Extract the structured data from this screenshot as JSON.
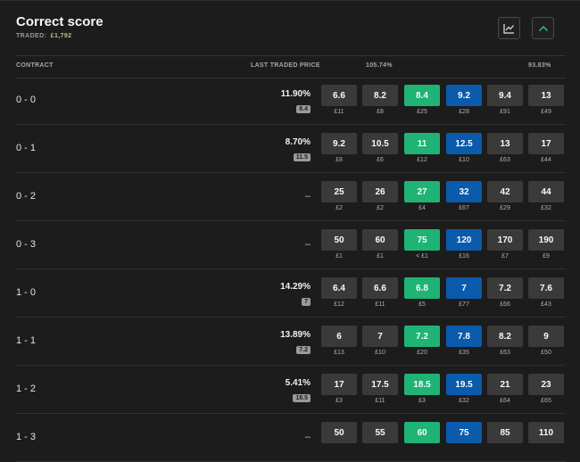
{
  "title": "Correct score",
  "traded_label": "TRADED:",
  "traded_value": "£1,792",
  "header": {
    "contract": "CONTRACT",
    "ltp": "LAST TRADED PRICE",
    "back_book": "105.74%",
    "lay_book": "93.83%"
  },
  "icons": {
    "chart": "line-chart-icon",
    "collapse": "chevron-up-icon"
  },
  "colors": {
    "best_back": "#1fb376",
    "best_lay": "#0a5bab",
    "price_cell": "#3a3a3a"
  },
  "rows": [
    {
      "contract": "0 - 0",
      "ltp": "11.90%",
      "ltp_price": "8.4",
      "prices": [
        "6.6",
        "8.2",
        "8.4",
        "9.2",
        "9.4",
        "13"
      ],
      "volumes": [
        "£11",
        "£8",
        "£25",
        "£28",
        "£91",
        "£49"
      ]
    },
    {
      "contract": "0 - 1",
      "ltp": "8.70%",
      "ltp_price": "11.5",
      "prices": [
        "9.2",
        "10.5",
        "11",
        "12.5",
        "13",
        "17"
      ],
      "volumes": [
        "£8",
        "£6",
        "£12",
        "£10",
        "£63",
        "£44"
      ]
    },
    {
      "contract": "0 - 2",
      "ltp": "–",
      "ltp_price": "",
      "prices": [
        "25",
        "26",
        "27",
        "32",
        "42",
        "44"
      ],
      "volumes": [
        "£2",
        "£2",
        "£4",
        "£67",
        "£29",
        "£32"
      ]
    },
    {
      "contract": "0 - 3",
      "ltp": "–",
      "ltp_price": "",
      "prices": [
        "50",
        "60",
        "75",
        "120",
        "170",
        "190"
      ],
      "volumes": [
        "£1",
        "£1",
        "< £1",
        "£16",
        "£7",
        "£9"
      ]
    },
    {
      "contract": "1 - 0",
      "ltp": "14.29%",
      "ltp_price": "7",
      "prices": [
        "6.4",
        "6.6",
        "6.8",
        "7",
        "7.2",
        "7.6"
      ],
      "volumes": [
        "£12",
        "£11",
        "£5",
        "£77",
        "£66",
        "£43"
      ]
    },
    {
      "contract": "1 - 1",
      "ltp": "13.89%",
      "ltp_price": "7.2",
      "prices": [
        "6",
        "7",
        "7.2",
        "7.8",
        "8.2",
        "9"
      ],
      "volumes": [
        "£13",
        "£10",
        "£20",
        "£35",
        "£63",
        "£50"
      ]
    },
    {
      "contract": "1 - 2",
      "ltp": "5.41%",
      "ltp_price": "18.5",
      "prices": [
        "17",
        "17.5",
        "18.5",
        "19.5",
        "21",
        "23"
      ],
      "volumes": [
        "£3",
        "£11",
        "£3",
        "£32",
        "£64",
        "£65"
      ]
    },
    {
      "contract": "1 - 3",
      "ltp": "–",
      "ltp_price": "",
      "prices": [
        "50",
        "55",
        "60",
        "75",
        "85",
        "110"
      ],
      "volumes": [
        "",
        "",
        "",
        "",
        "",
        ""
      ]
    }
  ]
}
